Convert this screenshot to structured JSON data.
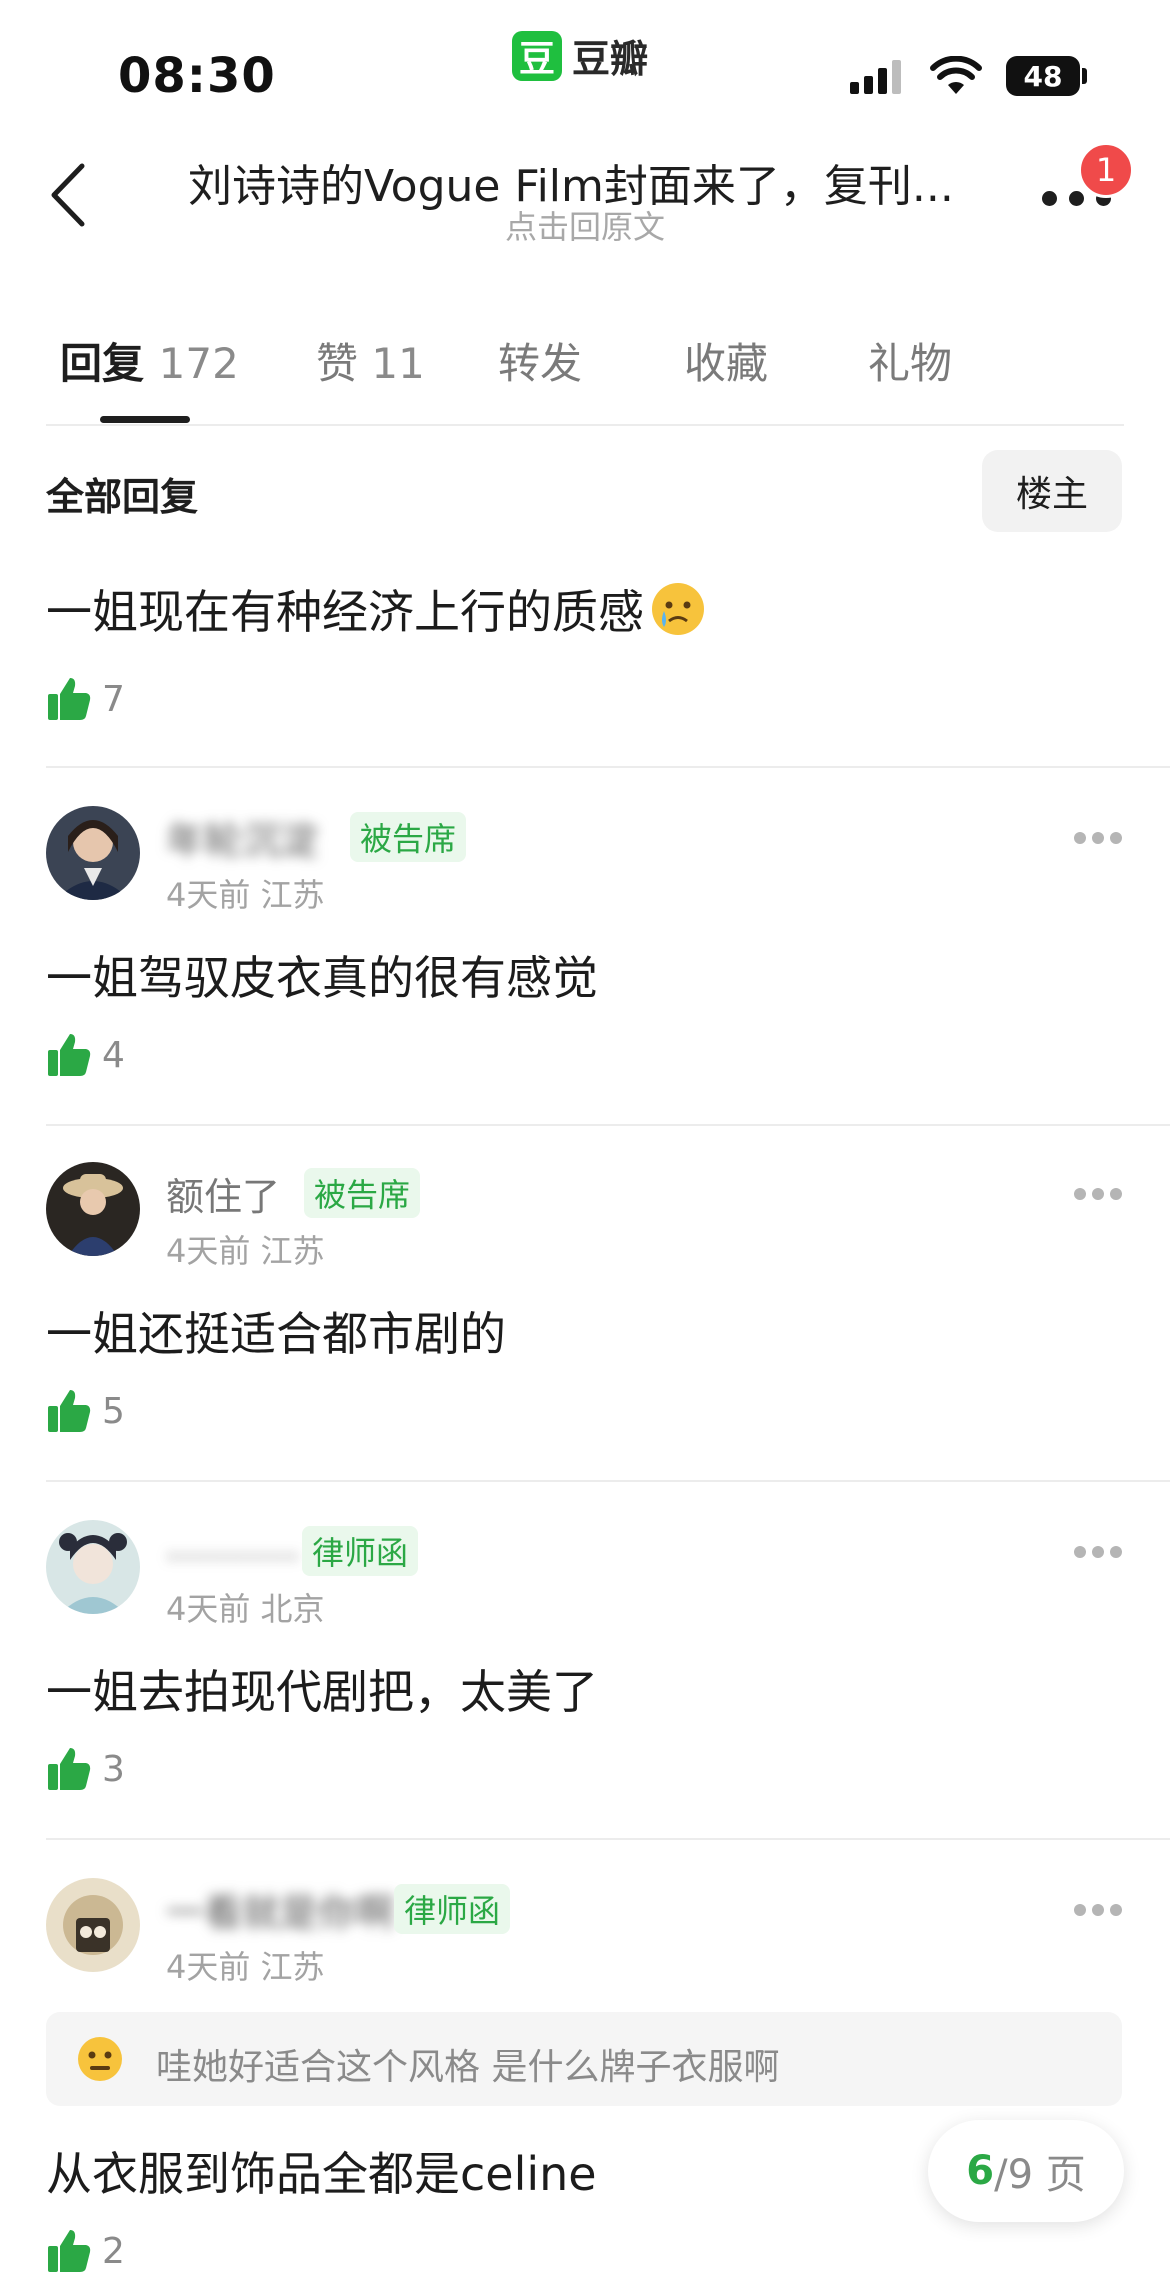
{
  "status_bar": {
    "time": "08:30",
    "app_brand_icon": "豆",
    "app_brand": "豆瓣",
    "battery": "48"
  },
  "nav": {
    "title": "刘诗诗的Vogue Film封面来了，复刊...",
    "subtitle": "点击回原文",
    "notification_count": "1"
  },
  "tabs": [
    {
      "label": "回复",
      "count": "172",
      "active": true
    },
    {
      "label": "赞",
      "count": "11"
    },
    {
      "label": "转发",
      "count": ""
    },
    {
      "label": "收藏",
      "count": ""
    },
    {
      "label": "礼物",
      "count": ""
    }
  ],
  "section": {
    "title": "全部回复",
    "filter_button": "楼主"
  },
  "comments": [
    {
      "text": "一姐现在有种经济上行的质感",
      "emoji": "crying-face",
      "likes": "7"
    },
    {
      "user": "年轮沉淀",
      "tag": "被告席",
      "time": "4天前",
      "location": "江苏",
      "text": "一姐驾驭皮衣真的很有感觉",
      "likes": "4"
    },
    {
      "user": "额住了",
      "tag": "被告席",
      "time": "4天前",
      "location": "江苏",
      "text": "一姐还挺适合都市剧的",
      "likes": "5"
    },
    {
      "user": "...........",
      "tag": "律师函",
      "time": "4天前",
      "location": "北京",
      "text": "一姐去拍现代剧把，太美了",
      "likes": "3"
    },
    {
      "user": "一看就是你啊",
      "tag": "律师函",
      "time": "4天前",
      "location": "江苏",
      "quote": "哇她好适合这个风格 是什么牌子衣服啊",
      "text": "从衣服到饰品全都是celine",
      "likes": "2"
    }
  ],
  "pager": {
    "current": "6",
    "total": "/9 页"
  },
  "colors": {
    "accent_green": "#2ba845",
    "brand_green": "#1fbf3f",
    "badge_red": "#f04a4a"
  }
}
